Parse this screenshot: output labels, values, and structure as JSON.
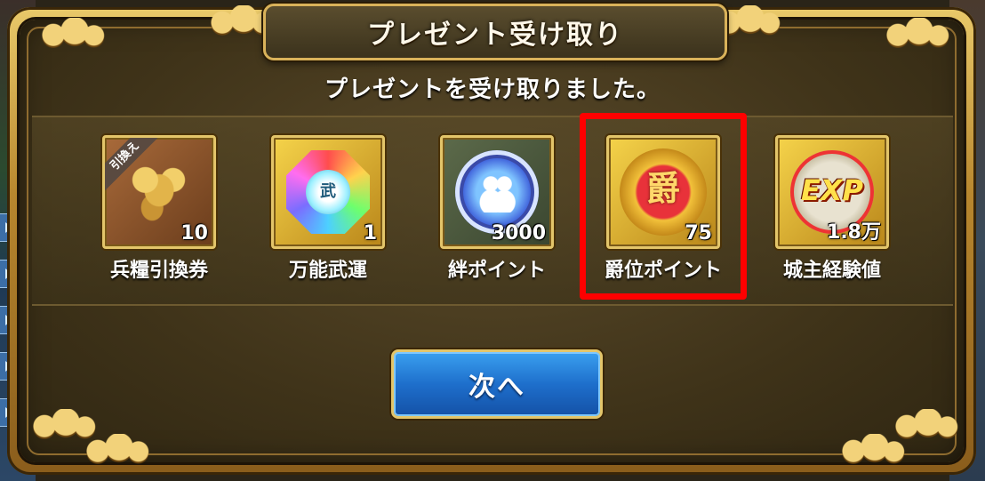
{
  "dialog": {
    "title": "プレゼント受け取り",
    "message": "プレゼントを受け取りました。"
  },
  "items": [
    {
      "name": "兵糧引換券",
      "quantity": "10",
      "icon": "wheat-icon",
      "badge": "引換え"
    },
    {
      "name": "万能武運",
      "quantity": "1",
      "icon": "rainbow-octagon-icon",
      "glyph": "武"
    },
    {
      "name": "絆ポイント",
      "quantity": "3000",
      "icon": "bond-coin-icon"
    },
    {
      "name": "爵位ポイント",
      "quantity": "75",
      "icon": "rank-coin-icon",
      "glyph": "爵",
      "highlighted": true
    },
    {
      "name": "城主経験値",
      "quantity": "1.8万",
      "icon": "exp-coin-icon",
      "glyph": "EXP"
    }
  ],
  "buttons": {
    "next_label": "次へ"
  },
  "colors": {
    "frame_gold": "#e3c56a",
    "highlight": "#ff0000",
    "button_blue": "#1e6fcc"
  }
}
